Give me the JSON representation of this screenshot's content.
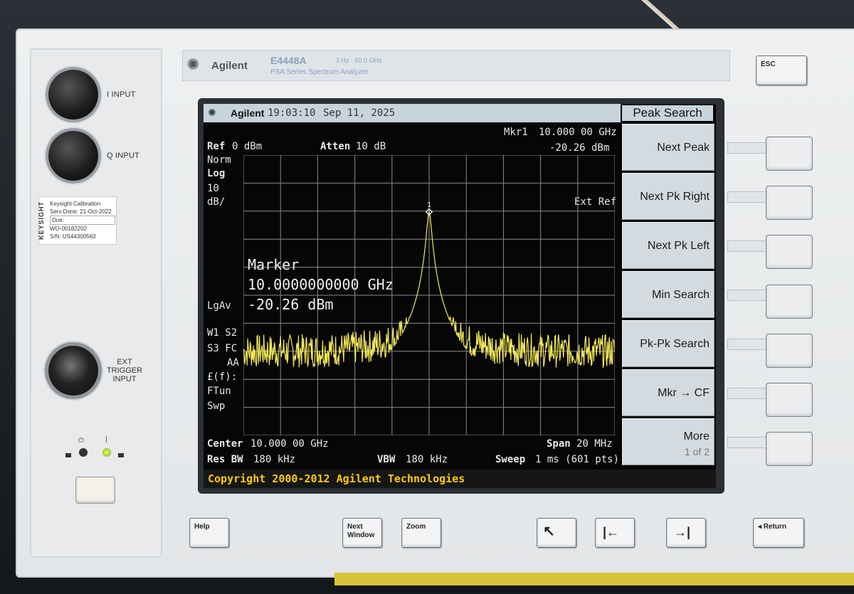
{
  "instrument": {
    "brand": "Agilent",
    "model": "E4448A",
    "range": "3 Hz - 50.0 GHz",
    "series": "PSA Series Spectrum Analyzer",
    "esc_label": "ESC"
  },
  "left_panel": {
    "i_input": "I INPUT",
    "q_input": "Q INPUT",
    "ext_trigger": [
      "EXT",
      "TRIGGER",
      "INPUT"
    ],
    "calibration": {
      "brand": "KEYSIGHT",
      "title": "Keysight Calibration",
      "serv_done": "Serv Done: 21-Oct-2022",
      "due": "Due:",
      "wo": "WO-00182202",
      "sn": "S/N: US44300563"
    }
  },
  "screen": {
    "topbar": {
      "brand": "Agilent",
      "time": "19:03:10",
      "date": "Sep 11, 2025"
    },
    "softkey_menu_title": "Peak Search",
    "softkeys": [
      {
        "label": "Next Peak"
      },
      {
        "label": "Next Pk Right"
      },
      {
        "label": "Next Pk Left"
      },
      {
        "label": "Min Search"
      },
      {
        "label": "Pk-Pk Search"
      },
      {
        "label": "Mkr → CF"
      },
      {
        "label": "More",
        "sub": "1 of 2"
      }
    ],
    "marker_readout": {
      "label": "Mkr1",
      "freq": "10.000 00 GHz",
      "amp": "-20.26 dBm"
    },
    "ref": {
      "label": "Ref",
      "value": "0 dBm"
    },
    "atten": {
      "label": "Atten",
      "value": "10 dB"
    },
    "left_annot": {
      "norm": "Norm",
      "log": "Log",
      "scale": "10",
      "unit": "dB/",
      "lgav": "LgAv",
      "w1s2": "W1  S2",
      "s3fc": "S3  FC",
      "aa": "AA",
      "ff": "£(f):",
      "ftun": "FTun",
      "swp": "Swp"
    },
    "ext_ref": "Ext Ref",
    "marker_box": {
      "title": "Marker",
      "freq": "10.0000000000 GHz",
      "amp": "-20.26 dBm"
    },
    "marker_number": "1",
    "center": {
      "label": "Center",
      "value": "10.000 00 GHz"
    },
    "span": {
      "label": "Span",
      "value": "20 MHz"
    },
    "res_bw": {
      "label": "Res BW",
      "value": "180 kHz"
    },
    "vbw": {
      "label": "VBW",
      "value": "180 kHz"
    },
    "sweep": {
      "label": "Sweep",
      "value": "1 ms (601 pts)"
    },
    "copyright": "Copyright 2000-2012 Agilent Technologies"
  },
  "trace": {
    "ref_level_dbm": 0,
    "db_per_div": 10,
    "divisions": 10,
    "peak_dbm": -20.26,
    "peak_position": 0.5,
    "noise_floor_dbm": -70,
    "trace_color": "#f2e85a",
    "grid_color": "#8a8a8a"
  },
  "bottom_buttons": {
    "help": "Help",
    "next_window": [
      "Next",
      "Window"
    ],
    "zoom": "Zoom",
    "up_arrow": "↖",
    "tab_left": "|←",
    "tab_right": "→|",
    "return": "◂ Return"
  }
}
